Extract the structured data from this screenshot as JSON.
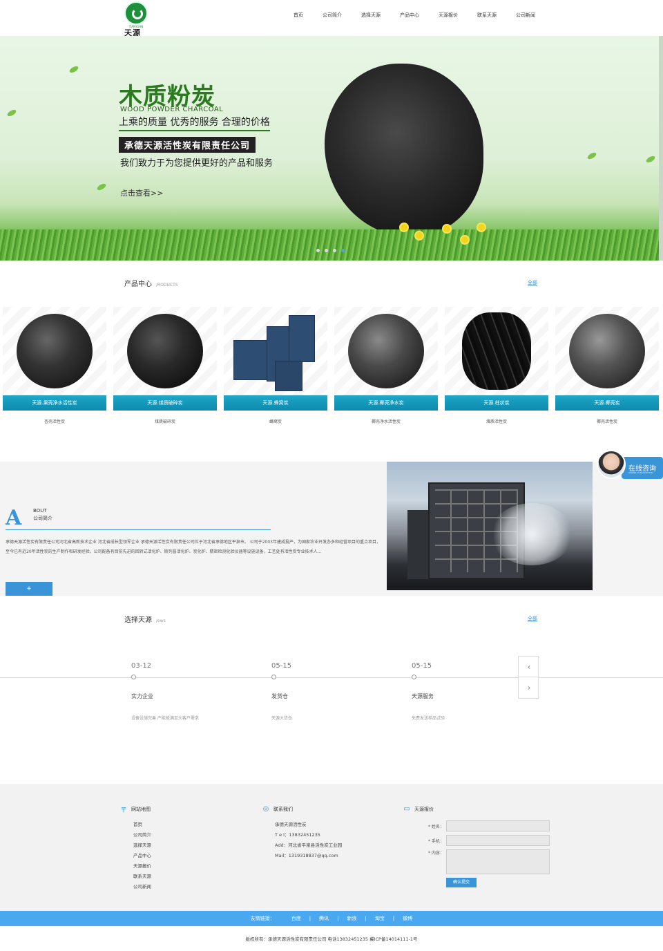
{
  "logo": {
    "en": "TIANYUAN",
    "cn": "天源"
  },
  "nav": [
    "首页",
    "公司简介",
    "选择天源",
    "产品中心",
    "天源报价",
    "联系天源",
    "公司新闻"
  ],
  "banner": {
    "title": "木质粉炭",
    "title_en": "WOOD POWDER CHARCOAL",
    "slogan": "上乘的质量 优秀的服务 合理的价格",
    "company": "承德天源活性炭有限责任公司",
    "service": "我们致力于为您提供更好的产品和服务",
    "more": "点击查看>>"
  },
  "products_section": {
    "title": "产品中心",
    "title_en": "/RODUCTS",
    "more": "全部",
    "items": [
      {
        "bar": "天源.果壳净水活性炭",
        "name": "杏壳活性炭"
      },
      {
        "bar": "天源.煤质破碎炭",
        "name": "煤质破碎炭"
      },
      {
        "bar": "天源.蜂窝炭",
        "name": "蜂窝炭"
      },
      {
        "bar": "天源.椰壳净水炭",
        "name": "椰壳净水活性炭"
      },
      {
        "bar": "天源.柱状炭",
        "name": "煤质活性炭"
      },
      {
        "bar": "天源.椰壳炭",
        "name": "椰壳活性炭"
      }
    ]
  },
  "about": {
    "letter": "A",
    "en": "BOUT",
    "cn": "公司简介",
    "text": "承德天源活性炭有限责任公司河北省高新技术企业  河北省成长型领军企业        承德天源活性炭有限责任公司位于河北省承德地区平泉市。        公司于2003年建成投产，为国家农业开发办多种经营项目的重点项目，至今已有近20年活性炭的生产制作和研发经验。公司配备有目前先进的回转式活化炉、斯列普活化炉、炭化炉、精密检测化验仪器等设施设备，工艺处有活性炭专业技术人...",
    "button": "+"
  },
  "consult": {
    "text": "在线咨询",
    "en": "ONLINE CONSULTATION"
  },
  "news_section": {
    "title": "选择天源",
    "title_en": "/ews",
    "more": "全部",
    "items": [
      {
        "date": "03-12",
        "title": "实力企业",
        "desc": "设备设施完善 产能能满足大客户需求"
      },
      {
        "date": "05-15",
        "title": "发货仓",
        "desc": "天源大货仓"
      },
      {
        "date": "05-15",
        "title": "天源服务",
        "desc": "免费发送样品试验"
      }
    ],
    "prev": "‹",
    "next": "›"
  },
  "footer": {
    "sitemap": {
      "title": "网站地图",
      "links": [
        "首页",
        "公司简介",
        "选择天源",
        "产品中心",
        "天源报价",
        "联系天源",
        "公司新闻"
      ]
    },
    "contact": {
      "title": "联系我们",
      "lines": [
        "承德天源活性炭",
        "T e l：13832451235",
        "Add：河北省平泉县活性炭工业园",
        "Mail：1319318837@qq.com"
      ]
    },
    "quote": {
      "title": "天源报价",
      "name_label": "* 姓名：",
      "phone_label": "* 手机：",
      "content_label": "* 内容：",
      "submit": "确认提交"
    }
  },
  "links": {
    "label": "友情链接：",
    "items": [
      "百度",
      "腾讯",
      "新浪",
      "淘宝",
      "微博"
    ]
  },
  "copyright": "版权所有：承德天源活性炭有限责任公司 电话13832451235     冀ICP备14014111-1号",
  "colors": {
    "accent": "#3a95d8",
    "product_bar": "#1fa7c9",
    "brand_green": "#1e8f3a",
    "links_bar": "#4aa8f0"
  }
}
